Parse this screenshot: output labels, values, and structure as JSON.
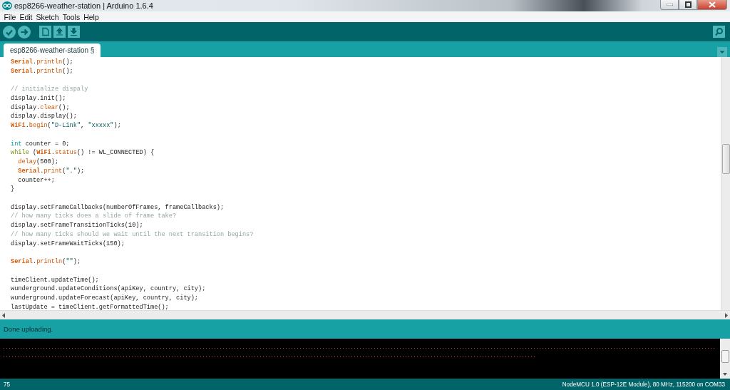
{
  "window": {
    "title": "esp8266-weather-station | Arduino 1.6.4"
  },
  "menu": [
    "File",
    "Edit",
    "Sketch",
    "Tools",
    "Help"
  ],
  "tabs": [
    {
      "label": "esp8266-weather-station §",
      "selected": true
    }
  ],
  "editor": {
    "lines": [
      {
        "segments": [
          {
            "text": "Serial",
            "kind": "keyword"
          },
          {
            "text": ".",
            "kind": "plain"
          },
          {
            "text": "println",
            "kind": "function"
          },
          {
            "text": "();",
            "kind": "plain"
          }
        ]
      },
      {
        "segments": [
          {
            "text": "Serial",
            "kind": "keyword"
          },
          {
            "text": ".",
            "kind": "plain"
          },
          {
            "text": "println",
            "kind": "function"
          },
          {
            "text": "();",
            "kind": "plain"
          }
        ]
      },
      {
        "space_before": true,
        "segments": [
          {
            "text": "// initialize dispaly",
            "kind": "comment"
          }
        ]
      },
      {
        "segments": [
          {
            "text": "display.init();",
            "kind": "plain"
          }
        ]
      },
      {
        "segments": [
          {
            "text": "display.",
            "kind": "plain"
          },
          {
            "text": "clear",
            "kind": "function"
          },
          {
            "text": "();",
            "kind": "plain"
          }
        ]
      },
      {
        "segments": [
          {
            "text": "display.display();",
            "kind": "plain"
          }
        ]
      },
      {
        "segments": [
          {
            "text": "WiFi",
            "kind": "keyword"
          },
          {
            "text": ".",
            "kind": "plain"
          },
          {
            "text": "begin",
            "kind": "function"
          },
          {
            "text": "(",
            "kind": "plain"
          },
          {
            "text": "\"D-Link\"",
            "kind": "string"
          },
          {
            "text": ", ",
            "kind": "plain"
          },
          {
            "text": "\"xxxxx\"",
            "kind": "string"
          },
          {
            "text": ");",
            "kind": "plain"
          }
        ]
      },
      {
        "space_before": true,
        "segments": [
          {
            "text": "int",
            "kind": "type"
          },
          {
            "text": " counter = 0;",
            "kind": "plain"
          }
        ]
      },
      {
        "segments": [
          {
            "text": "while",
            "kind": "control"
          },
          {
            "text": " (",
            "kind": "plain"
          },
          {
            "text": "WiFi",
            "kind": "keyword"
          },
          {
            "text": ".",
            "kind": "plain"
          },
          {
            "text": "status",
            "kind": "function"
          },
          {
            "text": "() != WL_CONNECTED) {",
            "kind": "plain"
          }
        ]
      },
      {
        "indented": true,
        "segments": [
          {
            "text": "delay",
            "kind": "function"
          },
          {
            "text": "(500);",
            "kind": "plain"
          }
        ]
      },
      {
        "indented": true,
        "segments": [
          {
            "text": "Serial",
            "kind": "keyword"
          },
          {
            "text": ".",
            "kind": "plain"
          },
          {
            "text": "print",
            "kind": "function"
          },
          {
            "text": "(",
            "kind": "plain"
          },
          {
            "text": "\".\"",
            "kind": "string"
          },
          {
            "text": ");",
            "kind": "plain"
          }
        ]
      },
      {
        "indented": true,
        "segments": [
          {
            "text": "counter++;",
            "kind": "plain"
          }
        ]
      },
      {
        "segments": [
          {
            "text": "}",
            "kind": "plain"
          }
        ]
      },
      {
        "space_before": true,
        "segments": [
          {
            "text": "display.setFrameCallbacks(numberOfFrames, frameCallbacks);",
            "kind": "plain"
          }
        ]
      },
      {
        "segments": [
          {
            "text": "// how many ticks does a slide of frame take?",
            "kind": "comment"
          }
        ]
      },
      {
        "segments": [
          {
            "text": "display.setFrameTransitionTicks(10);",
            "kind": "plain"
          }
        ]
      },
      {
        "segments": [
          {
            "text": "// how many ticks should we wait until the next transition begins?",
            "kind": "comment"
          }
        ]
      },
      {
        "segments": [
          {
            "text": "display.setFrameWaitTicks(150);",
            "kind": "plain"
          }
        ]
      },
      {
        "space_before": true,
        "segments": [
          {
            "text": "Serial",
            "kind": "keyword"
          },
          {
            "text": ".",
            "kind": "plain"
          },
          {
            "text": "println",
            "kind": "function"
          },
          {
            "text": "(",
            "kind": "plain"
          },
          {
            "text": "\"\"",
            "kind": "string"
          },
          {
            "text": ");",
            "kind": "plain"
          }
        ]
      },
      {
        "space_before": true,
        "segments": [
          {
            "text": "timeClient.updateTime();",
            "kind": "plain"
          }
        ]
      },
      {
        "segments": [
          {
            "text": "wunderground.updateConditions(apiKey, country, city);",
            "kind": "plain"
          }
        ]
      },
      {
        "segments": [
          {
            "text": "wunderground.updateForecast(apiKey, country, city);",
            "kind": "plain"
          }
        ]
      },
      {
        "segments": [
          {
            "text": "lastUpdate = timeClient.getFormattedTime();",
            "kind": "plain"
          }
        ]
      }
    ]
  },
  "status": {
    "message": "Done uploading."
  },
  "console": {
    "lines": [
      "..........................................................................................................................................................................................................................................................",
      "..........................................................................................................................................................................................."
    ]
  },
  "footer": {
    "line_number": "75",
    "board": "NodeMCU 1.0 (ESP-12E Module), 80 MHz, 115200 on COM33"
  }
}
